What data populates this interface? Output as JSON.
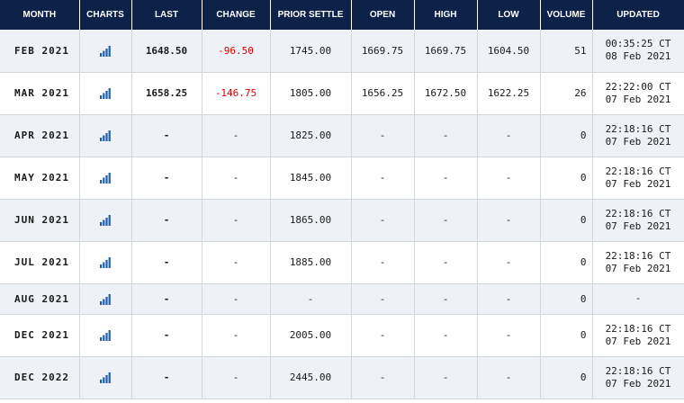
{
  "columns": {
    "month": "MONTH",
    "charts": "CHARTS",
    "last": "LAST",
    "change": "CHANGE",
    "prior_settle": "PRIOR SETTLE",
    "open": "OPEN",
    "high": "HIGH",
    "low": "LOW",
    "volume": "VOLUME",
    "updated": "UPDATED"
  },
  "chart_icon": "bar-chart-icon",
  "colors": {
    "header_bg": "#0c2249",
    "chart_icon": "#1f5fae",
    "negative": "#e00000",
    "row_alt": "#eef2f6"
  },
  "rows": [
    {
      "month": "FEB 2021",
      "last": "1648.50",
      "change": "-96.50",
      "prior_settle": "1745.00",
      "open": "1669.75",
      "high": "1669.75",
      "low": "1604.50",
      "volume": "51",
      "updated_time": "00:35:25 CT",
      "updated_date": "08 Feb 2021"
    },
    {
      "month": "MAR 2021",
      "last": "1658.25",
      "change": "-146.75",
      "prior_settle": "1805.00",
      "open": "1656.25",
      "high": "1672.50",
      "low": "1622.25",
      "volume": "26",
      "updated_time": "22:22:00 CT",
      "updated_date": "07 Feb 2021"
    },
    {
      "month": "APR 2021",
      "last": "-",
      "change": "-",
      "prior_settle": "1825.00",
      "open": "-",
      "high": "-",
      "low": "-",
      "volume": "0",
      "updated_time": "22:18:16 CT",
      "updated_date": "07 Feb 2021"
    },
    {
      "month": "MAY 2021",
      "last": "-",
      "change": "-",
      "prior_settle": "1845.00",
      "open": "-",
      "high": "-",
      "low": "-",
      "volume": "0",
      "updated_time": "22:18:16 CT",
      "updated_date": "07 Feb 2021"
    },
    {
      "month": "JUN 2021",
      "last": "-",
      "change": "-",
      "prior_settle": "1865.00",
      "open": "-",
      "high": "-",
      "low": "-",
      "volume": "0",
      "updated_time": "22:18:16 CT",
      "updated_date": "07 Feb 2021"
    },
    {
      "month": "JUL 2021",
      "last": "-",
      "change": "-",
      "prior_settle": "1885.00",
      "open": "-",
      "high": "-",
      "low": "-",
      "volume": "0",
      "updated_time": "22:18:16 CT",
      "updated_date": "07 Feb 2021"
    },
    {
      "month": "AUG 2021",
      "last": "-",
      "change": "-",
      "prior_settle": "-",
      "open": "-",
      "high": "-",
      "low": "-",
      "volume": "0",
      "updated_time": "-",
      "updated_date": ""
    },
    {
      "month": "DEC 2021",
      "last": "-",
      "change": "-",
      "prior_settle": "2005.00",
      "open": "-",
      "high": "-",
      "low": "-",
      "volume": "0",
      "updated_time": "22:18:16 CT",
      "updated_date": "07 Feb 2021"
    },
    {
      "month": "DEC 2022",
      "last": "-",
      "change": "-",
      "prior_settle": "2445.00",
      "open": "-",
      "high": "-",
      "low": "-",
      "volume": "0",
      "updated_time": "22:18:16 CT",
      "updated_date": "07 Feb 2021"
    }
  ]
}
